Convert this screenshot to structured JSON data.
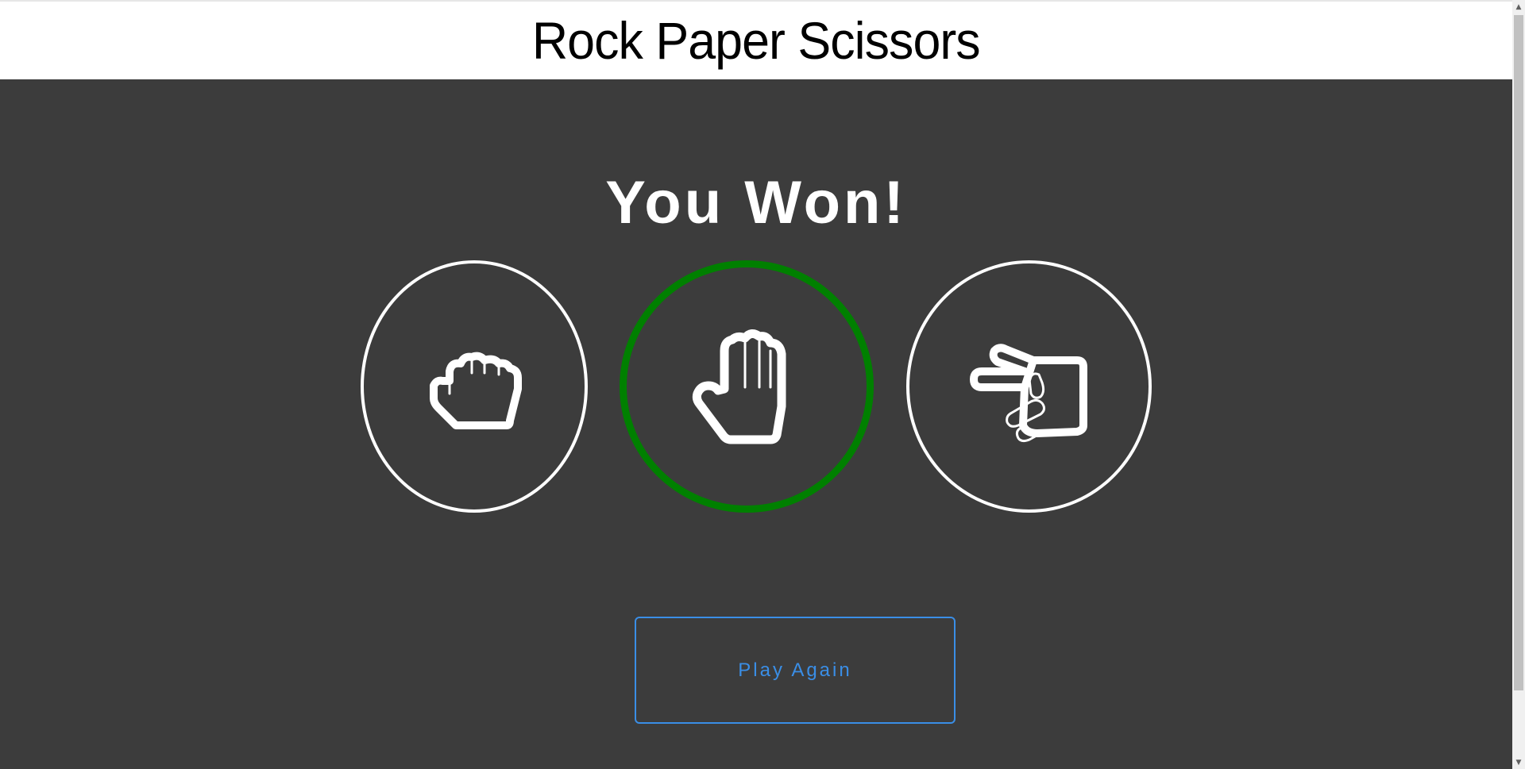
{
  "header": {
    "title": "Rock Paper Scissors"
  },
  "game": {
    "result_text": "You Won!",
    "selected_choice": "paper",
    "choices": [
      {
        "name": "rock",
        "icon": "fist-icon",
        "border_color": "#ffffff"
      },
      {
        "name": "paper",
        "icon": "open-hand-icon",
        "border_color": "#008000"
      },
      {
        "name": "scissors",
        "icon": "scissors-hand-icon",
        "border_color": "#ffffff"
      }
    ],
    "play_again_label": "Play Again"
  },
  "colors": {
    "background": "#3c3c3c",
    "header_background": "#ffffff",
    "winner_ring": "#008000",
    "button_accent": "#3a8ee6",
    "icon_stroke": "#ffffff"
  },
  "scrollbar": {
    "up_arrow": "▲",
    "down_arrow": "▼"
  }
}
